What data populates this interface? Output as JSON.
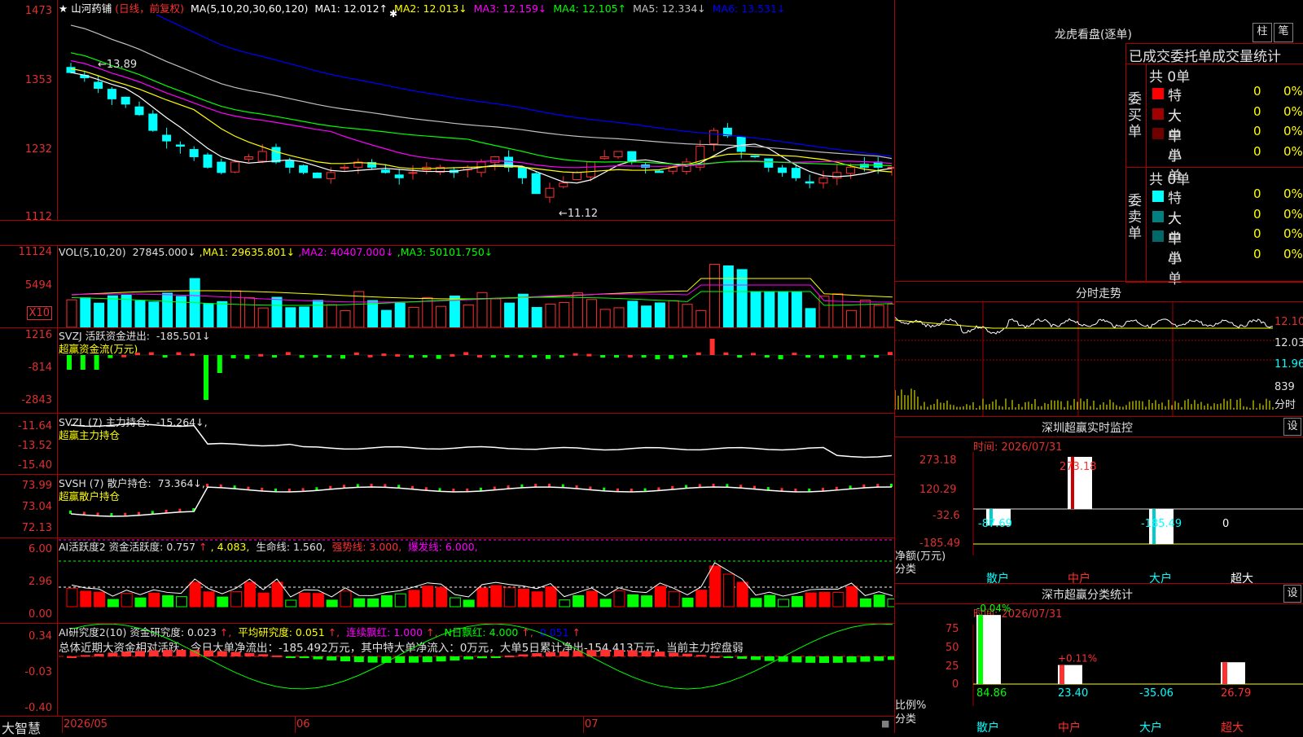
{
  "main": {
    "title": "山河药铺",
    "mode": "(日线，前复权)",
    "ma_params": "MA(5,10,20,30,60,120)",
    "ma_values": [
      {
        "label": "MA1:",
        "value": "12.012↑",
        "color": "#ffffff"
      },
      {
        "label": "MA2:",
        "value": "12.013↓",
        "color": "#ffff00"
      },
      {
        "label": "MA3:",
        "value": "12.159↓",
        "color": "#ff00ff"
      },
      {
        "label": "MA4:",
        "value": "12.105↑",
        "color": "#00ff00"
      },
      {
        "label": "MA5:",
        "value": "12.334↓",
        "color": "#c0c0c0"
      },
      {
        "label": "MA6:",
        "value": "13.531↓",
        "color": "#0000ff"
      }
    ],
    "y_ticks": [
      "1473",
      "1353",
      "1232",
      "1112"
    ],
    "high_label": "13.89",
    "low_label": "←11.12",
    "colors": {
      "up": "#ff3030",
      "down": "#00ffff",
      "ma1": "#ffffff",
      "ma2": "#ffff00",
      "ma3": "#ff00ff",
      "ma4": "#00ff00",
      "ma5": "#c0c0c0",
      "ma6": "#0000ff"
    }
  },
  "vol": {
    "label": "VOL(5,10,20)",
    "value": "27845.000↓",
    "ma": [
      {
        "label": "MA1:",
        "value": "29635.801↓",
        "color": "#ffff00"
      },
      {
        "label": "MA2:",
        "value": "40407.000↓",
        "color": "#ff00ff"
      },
      {
        "label": "MA3:",
        "value": "50101.750↓",
        "color": "#00ff00"
      }
    ],
    "y_ticks": [
      "11124",
      "5494"
    ],
    "unit": "X10"
  },
  "svzj": {
    "label": "SVZJ  活跃资金进出:",
    "value": "-185.501↓",
    "sub": "超赢资金流(万元)",
    "y_ticks": [
      "1216",
      "-814",
      "-2843"
    ]
  },
  "svzl": {
    "label": "SVZL (7) 主力持仓:",
    "value": "-15.264↓,",
    "sub": "超赢主力持仓",
    "y_ticks": [
      "-11.64",
      "-13.52",
      "-15.40"
    ]
  },
  "svsh": {
    "label": "SVSH (7) 散户持仓:",
    "value": "73.364↓,",
    "sub": "超赢散户持仓",
    "y_ticks": [
      "73.99",
      "73.04",
      "72.13"
    ]
  },
  "ai1": {
    "parts": [
      {
        "text": "AI活跃度2 资金活跃度: 0.757",
        "color": "#e0e0e0"
      },
      {
        "text": "↑",
        "color": "#ff3030"
      },
      {
        "text": ", 4.083,",
        "color": "#ffff00"
      },
      {
        "text": " 生命线: 1.560,",
        "color": "#e0e0e0"
      },
      {
        "text": " 强势线: 3.000,",
        "color": "#ff3030"
      },
      {
        "text": " 爆发线: 6.000,",
        "color": "#ff00ff"
      }
    ],
    "y_ticks": [
      "6.00",
      "2.96",
      "0.00"
    ]
  },
  "ai2": {
    "parts": [
      {
        "text": "AI研究度2(10) 资金研究度: 0.023",
        "color": "#e0e0e0"
      },
      {
        "text": "↑,",
        "color": "#ff3030"
      },
      {
        "text": " 平均研究度: 0.051",
        "color": "#ffff00"
      },
      {
        "text": "↑,",
        "color": "#ff3030"
      },
      {
        "text": " 连续飘红: 1.000",
        "color": "#ff00ff"
      },
      {
        "text": "↑,",
        "color": "#ff3030"
      },
      {
        "text": " N日飘红: 4.000",
        "color": "#00ff00"
      },
      {
        "text": "↑,",
        "color": "#ff3030"
      },
      {
        "text": " 0.051",
        "color": "#0000ff"
      },
      {
        "text": "↑",
        "color": "#ff3030"
      }
    ],
    "comment": "总体近期大资金相对活跃，今日大单净流出：-185.492万元，其中特大单净流入：0万元，大单5日累计净出-154.413万元，当前主力控盘弱",
    "y_ticks": [
      "0.34",
      "-0.03",
      "-0.40"
    ]
  },
  "xaxis": {
    "logo": "大智慧",
    "labels": [
      "2026/05",
      "06",
      "07"
    ]
  },
  "right": {
    "dragon_title": "龙虎看盘(逐单)",
    "btn1": "柱",
    "btn2": "笔",
    "stats_title": "已成交委托单成交量统计",
    "buy": {
      "side": "委买单",
      "count": "共 0单",
      "rows": [
        {
          "name": "特大",
          "qty": "0",
          "pct": "0%",
          "color": "#ff0000"
        },
        {
          "name": "大单",
          "qty": "0",
          "pct": "0%",
          "color": "#a00000"
        },
        {
          "name": "中单",
          "qty": "0",
          "pct": "0%",
          "color": "#700000"
        },
        {
          "name": "小单",
          "qty": "0",
          "pct": "0%",
          "color": "#000000"
        }
      ]
    },
    "sell": {
      "side": "委卖单",
      "count": "共 0单",
      "rows": [
        {
          "name": "特大",
          "qty": "0",
          "pct": "0%",
          "color": "#00ffff"
        },
        {
          "name": "大单",
          "qty": "0",
          "pct": "0%",
          "color": "#008080"
        },
        {
          "name": "中单",
          "qty": "0",
          "pct": "0%",
          "color": "#006868"
        },
        {
          "name": "小单",
          "qty": "0",
          "pct": "0%",
          "color": "#000000"
        }
      ]
    },
    "intraday": {
      "title": "分时走势",
      "prices": [
        "12.10",
        "12.03",
        "11.96"
      ],
      "vol": "839",
      "vol_label": "分时"
    },
    "sz_monitor": {
      "title": "深圳超赢实时监控",
      "btn": "设",
      "time": "时间: 2026/07/31",
      "y_ticks": [
        "273.18",
        "120.29",
        "-32.6",
        "-185.49"
      ],
      "y_label": "净额(万元)",
      "x_label": "分类",
      "values": [
        {
          "cat": "散户",
          "value": "-87.69",
          "color": "#00ffff"
        },
        {
          "cat": "中户",
          "value": "273.18",
          "color": "#ff3030"
        },
        {
          "cat": "大户",
          "value": "-185.49",
          "color": "#00ffff"
        },
        {
          "cat": "超大",
          "value": "0",
          "color": "#ffffff"
        }
      ]
    },
    "sz_stats": {
      "title": "深市超赢分类统计",
      "btn": "设",
      "time": "时间: 2026/07/31",
      "y_ticks": [
        "75",
        "50",
        "25",
        "0"
      ],
      "y_label": "比例%",
      "x_label": "分类",
      "bars": [
        {
          "cat": "散户",
          "top": "-0.04%",
          "bottom": "84.86",
          "color": "#00ff00"
        },
        {
          "cat": "中户",
          "top": "+0.11%",
          "bottom": "23.40",
          "color": "#ff3030"
        },
        {
          "cat": "大户",
          "top": "",
          "bottom": "-35.06",
          "color": "#00ffff"
        },
        {
          "cat": "超大",
          "top": "",
          "bottom": "26.79",
          "color": "#ff3030"
        }
      ]
    }
  }
}
